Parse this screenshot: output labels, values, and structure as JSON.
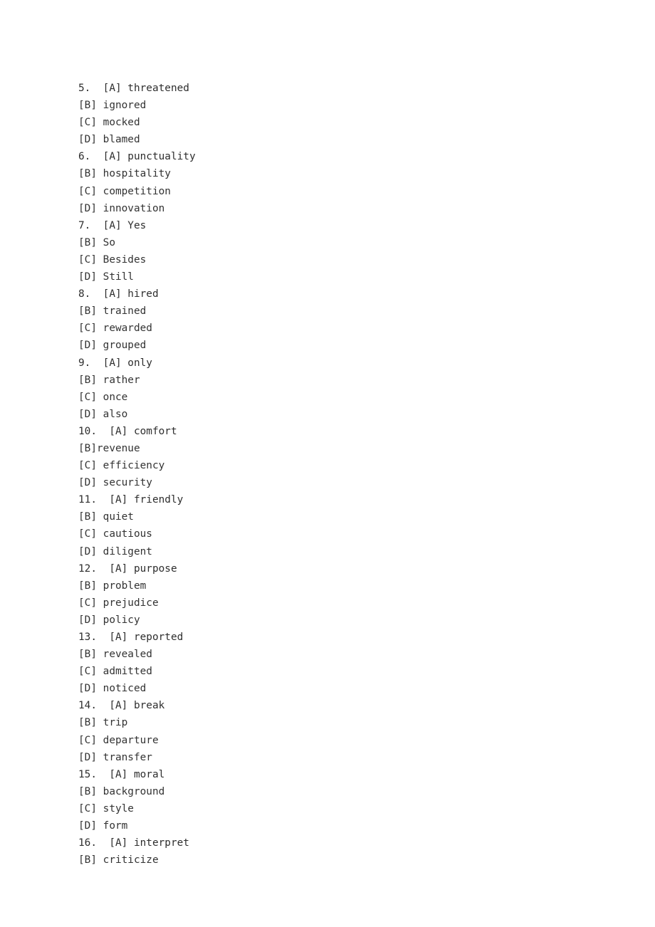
{
  "document": {
    "type": "exam-answer-options",
    "background_color": "#ffffff",
    "text_color": "#333333",
    "lines": [
      "5.  [A] threatened",
      "[B] ignored",
      "[C] mocked",
      "[D] blamed",
      "6.  [A] punctuality",
      "[B] hospitality",
      "[C] competition",
      "[D] innovation",
      "7.  [A] Yes",
      "[B] So",
      "[C] Besides",
      "[D] Still",
      "8.  [A] hired",
      "[B] trained",
      "[C] rewarded",
      "[D] grouped",
      "9.  [A] only",
      "[B] rather",
      "[C] once",
      "[D] also",
      "10.  [A] comfort",
      "[B]revenue",
      "[C] efficiency",
      "[D] security",
      "11.  [A] friendly",
      "[B] quiet",
      "[C] cautious",
      "[D] diligent",
      "12.  [A] purpose",
      "[B] problem",
      "[C] prejudice",
      "[D] policy",
      "13.  [A] reported",
      "[B] revealed",
      "[C] admitted",
      "[D] noticed",
      "14.  [A] break",
      "[B] trip",
      "[C] departure",
      "[D] transfer",
      "15.  [A] moral",
      "[B] background",
      "[C] style",
      "[D] form",
      "16.  [A] interpret",
      "[B] criticize"
    ],
    "questions": [
      {
        "number": "5.",
        "options": [
          {
            "label": "[A]",
            "text": "threatened"
          },
          {
            "label": "[B]",
            "text": "ignored"
          },
          {
            "label": "[C]",
            "text": "mocked"
          },
          {
            "label": "[D]",
            "text": "blamed"
          }
        ]
      },
      {
        "number": "6.",
        "options": [
          {
            "label": "[A]",
            "text": "punctuality"
          },
          {
            "label": "[B]",
            "text": "hospitality"
          },
          {
            "label": "[C]",
            "text": "competition"
          },
          {
            "label": "[D]",
            "text": "innovation"
          }
        ]
      },
      {
        "number": "7.",
        "options": [
          {
            "label": "[A]",
            "text": "Yes"
          },
          {
            "label": "[B]",
            "text": "So"
          },
          {
            "label": "[C]",
            "text": "Besides"
          },
          {
            "label": "[D]",
            "text": "Still"
          }
        ]
      },
      {
        "number": "8.",
        "options": [
          {
            "label": "[A]",
            "text": "hired"
          },
          {
            "label": "[B]",
            "text": "trained"
          },
          {
            "label": "[C]",
            "text": "rewarded"
          },
          {
            "label": "[D]",
            "text": "grouped"
          }
        ]
      },
      {
        "number": "9.",
        "options": [
          {
            "label": "[A]",
            "text": "only"
          },
          {
            "label": "[B]",
            "text": "rather"
          },
          {
            "label": "[C]",
            "text": "once"
          },
          {
            "label": "[D]",
            "text": "also"
          }
        ]
      },
      {
        "number": "10.",
        "options": [
          {
            "label": "[A]",
            "text": "comfort"
          },
          {
            "label": "[B]",
            "text": "revenue"
          },
          {
            "label": "[C]",
            "text": "efficiency"
          },
          {
            "label": "[D]",
            "text": "security"
          }
        ]
      },
      {
        "number": "11.",
        "options": [
          {
            "label": "[A]",
            "text": "friendly"
          },
          {
            "label": "[B]",
            "text": "quiet"
          },
          {
            "label": "[C]",
            "text": "cautious"
          },
          {
            "label": "[D]",
            "text": "diligent"
          }
        ]
      },
      {
        "number": "12.",
        "options": [
          {
            "label": "[A]",
            "text": "purpose"
          },
          {
            "label": "[B]",
            "text": "problem"
          },
          {
            "label": "[C]",
            "text": "prejudice"
          },
          {
            "label": "[D]",
            "text": "policy"
          }
        ]
      },
      {
        "number": "13.",
        "options": [
          {
            "label": "[A]",
            "text": "reported"
          },
          {
            "label": "[B]",
            "text": "revealed"
          },
          {
            "label": "[C]",
            "text": "admitted"
          },
          {
            "label": "[D]",
            "text": "noticed"
          }
        ]
      },
      {
        "number": "14.",
        "options": [
          {
            "label": "[A]",
            "text": "break"
          },
          {
            "label": "[B]",
            "text": "trip"
          },
          {
            "label": "[C]",
            "text": "departure"
          },
          {
            "label": "[D]",
            "text": "transfer"
          }
        ]
      },
      {
        "number": "15.",
        "options": [
          {
            "label": "[A]",
            "text": "moral"
          },
          {
            "label": "[B]",
            "text": "background"
          },
          {
            "label": "[C]",
            "text": "style"
          },
          {
            "label": "[D]",
            "text": "form"
          }
        ]
      },
      {
        "number": "16.",
        "options": [
          {
            "label": "[A]",
            "text": "interpret"
          },
          {
            "label": "[B]",
            "text": "criticize"
          }
        ]
      }
    ]
  }
}
